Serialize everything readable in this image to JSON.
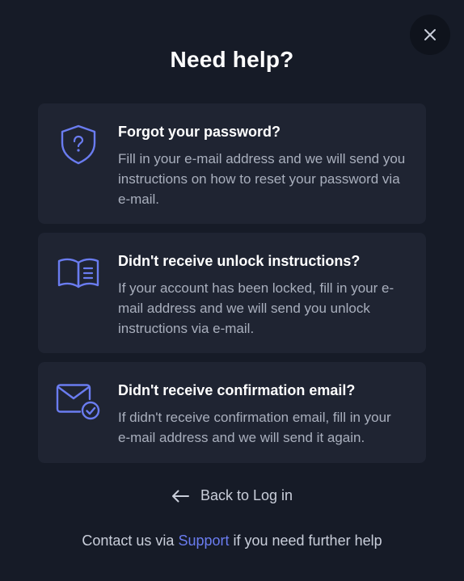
{
  "dialog": {
    "title": "Need help?",
    "close_icon": "close-icon"
  },
  "options": [
    {
      "icon": "shield-question-icon",
      "heading": "Forgot your password?",
      "description": "Fill in your e-mail address and we will send you instructions on how to reset your password via e-mail."
    },
    {
      "icon": "open-book-icon",
      "heading": "Didn't receive unlock instructions?",
      "description": "If your account has been locked, fill in your e-mail address and we will send you unlock instructions via e-mail."
    },
    {
      "icon": "mail-check-icon",
      "heading": "Didn't receive confirmation email?",
      "description": "If didn't receive confirmation email, fill in your e-mail address and we will send it again."
    }
  ],
  "back": {
    "icon": "arrow-left-icon",
    "label": "Back to Log in"
  },
  "footer": {
    "prefix": "Contact us via ",
    "link_label": "Support",
    "suffix": " if you need further help"
  },
  "colors": {
    "background": "#161b27",
    "card": "#1f2432",
    "accent": "#6a7cf0",
    "muted_text": "#a9afbd"
  }
}
